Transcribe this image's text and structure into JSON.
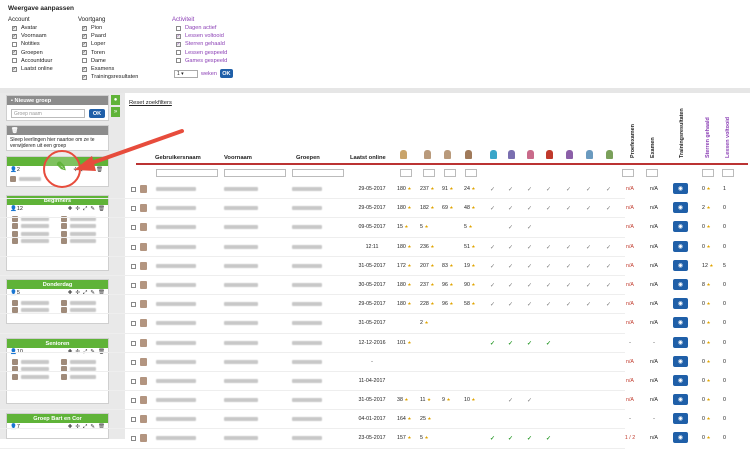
{
  "settings": {
    "title": "Weergave aanpassen",
    "account": {
      "header": "Account",
      "items": [
        {
          "label": "Avatar",
          "checked": true
        },
        {
          "label": "Voornaam",
          "checked": true
        },
        {
          "label": "Notities",
          "checked": false
        },
        {
          "label": "Groepen",
          "checked": true
        },
        {
          "label": "Accountduur",
          "checked": false
        },
        {
          "label": "Laatst online",
          "checked": true
        }
      ]
    },
    "voortgang": {
      "header": "Voortgang",
      "items": [
        {
          "label": "Pion",
          "checked": true
        },
        {
          "label": "Paard",
          "checked": true
        },
        {
          "label": "Loper",
          "checked": true
        },
        {
          "label": "Toren",
          "checked": true
        },
        {
          "label": "Dame",
          "checked": false
        },
        {
          "label": "Examens",
          "checked": true
        },
        {
          "label": "Trainingsresultaten",
          "checked": true
        }
      ]
    },
    "activiteit": {
      "header": "Activiteit",
      "items": [
        {
          "label": "Dagen actief",
          "checked": false
        },
        {
          "label": "Lessen voltooid",
          "checked": true
        },
        {
          "label": "Sterren gehaald",
          "checked": true
        },
        {
          "label": "Lessen gespeeld",
          "checked": false
        },
        {
          "label": "Games gespeeld",
          "checked": false
        }
      ]
    },
    "weeks_value": "1",
    "weeks_label": "weken",
    "ok_label": "OK"
  },
  "sidebar": {
    "new_group_title": "Nieuwe groep",
    "new_group_placeholder": "Groep naam",
    "ok_label": "OK",
    "trash_hint": "Sleep leerlingen hier naartoe om ze te verwijderen uit een groep",
    "groups": [
      {
        "name": "",
        "count": "2"
      },
      {
        "name": "Beginners",
        "count": "12"
      },
      {
        "name": "Donderdag",
        "count": "5"
      },
      {
        "name": "Senioren",
        "count": "10"
      },
      {
        "name": "Groep Bart en Cor",
        "count": "7"
      }
    ]
  },
  "main": {
    "reset_label": "Reset zoekfilters",
    "headers": {
      "username": "Gebruikersnaam",
      "firstname": "Voornaam",
      "groups": "Groepen",
      "last_online": "Laatst online",
      "proefexamen": "Proefexamen",
      "examen": "Examen",
      "training": "Trainingsresultaten",
      "stars": "Sterren gehaald",
      "lessons": "Lessen voltooid"
    },
    "rows": [
      {
        "date": "29-05-2017",
        "v1": "180",
        "v2": "237",
        "v3": "91",
        "v4": "24",
        "ticks": "some",
        "pe": "n/A",
        "ex": "n/A",
        "stars": "0",
        "lessons": "1"
      },
      {
        "date": "29-05-2017",
        "v1": "180",
        "v2": "182",
        "v3": "69",
        "v4": "48",
        "ticks": "some",
        "pe": "n/A",
        "ex": "n/A",
        "stars": "2",
        "lessons": "0"
      },
      {
        "date": "09-05-2017",
        "v1": "15",
        "v2": "5",
        "v3": "",
        "v4": "5",
        "ticks": "few",
        "pe": "n/A",
        "ex": "n/A",
        "stars": "0",
        "lessons": "0"
      },
      {
        "date": "12:11",
        "v1": "180",
        "v2": "236",
        "v3": "",
        "v4": "51",
        "ticks": "some",
        "pe": "n/A",
        "ex": "n/A",
        "stars": "0",
        "lessons": "0"
      },
      {
        "date": "31-05-2017",
        "v1": "172",
        "v2": "207",
        "v3": "83",
        "v4": "19",
        "ticks": "some",
        "pe": "n/A",
        "ex": "n/A",
        "stars": "12",
        "lessons": "5"
      },
      {
        "date": "30-05-2017",
        "v1": "180",
        "v2": "237",
        "v3": "96",
        "v4": "90",
        "ticks": "some",
        "pe": "n/A",
        "ex": "n/A",
        "stars": "8",
        "lessons": "0"
      },
      {
        "date": "29-05-2017",
        "v1": "180",
        "v2": "228",
        "v3": "96",
        "v4": "58",
        "ticks": "some",
        "pe": "n/A",
        "ex": "n/A",
        "stars": "0",
        "lessons": "0"
      },
      {
        "date": "31-05-2017",
        "v1": "",
        "v2": "2",
        "v3": "",
        "v4": "",
        "ticks": "none",
        "pe": "n/A",
        "ex": "n/A",
        "stars": "0",
        "lessons": "0"
      },
      {
        "date": "12-12-2016",
        "v1": "101",
        "v2": "",
        "v3": "",
        "v4": "",
        "ticks": "green",
        "pe": "-",
        "ex": "-",
        "stars": "0",
        "lessons": "0"
      },
      {
        "date": "-",
        "v1": "",
        "v2": "",
        "v3": "",
        "v4": "",
        "ticks": "none",
        "pe": "n/A",
        "ex": "n/A",
        "stars": "0",
        "lessons": "0"
      },
      {
        "date": "11-04-2017",
        "v1": "",
        "v2": "",
        "v3": "",
        "v4": "",
        "ticks": "none",
        "pe": "n/A",
        "ex": "n/A",
        "stars": "0",
        "lessons": "0"
      },
      {
        "date": "31-05-2017",
        "v1": "38",
        "v2": "11",
        "v3": "9",
        "v4": "10",
        "ticks": "few",
        "pe": "n/A",
        "ex": "n/A",
        "stars": "0",
        "lessons": "0"
      },
      {
        "date": "04-01-2017",
        "v1": "164",
        "v2": "25",
        "v3": "",
        "v4": "",
        "ticks": "none",
        "pe": "-",
        "ex": "-",
        "stars": "0",
        "lessons": "0"
      },
      {
        "date": "23-05-2017",
        "v1": "157",
        "v2": "5",
        "v3": "",
        "v4": "",
        "ticks": "green",
        "pe": "1 / 2",
        "ex": "n/A",
        "stars": "0",
        "lessons": "0"
      }
    ]
  },
  "colors": {
    "accent": "#1f5fa8",
    "group_green": "#5fb338",
    "highlight_red": "#e74c3c",
    "purple": "#8b3fb5"
  }
}
